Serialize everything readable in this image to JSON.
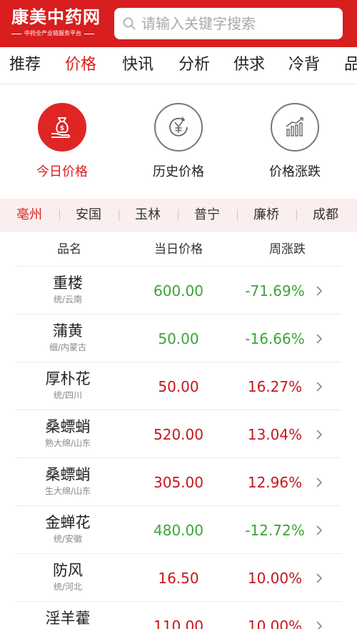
{
  "header": {
    "logo_main": "康美中药网",
    "logo_sub": "中药全产业链服务平台",
    "search_placeholder": "请输入关键字搜索"
  },
  "nav": {
    "tabs": [
      {
        "label": "推荐"
      },
      {
        "label": "价格"
      },
      {
        "label": "快讯"
      },
      {
        "label": "分析"
      },
      {
        "label": "供求"
      },
      {
        "label": "冷背"
      },
      {
        "label": "品"
      }
    ],
    "active": "价格"
  },
  "categories": [
    {
      "label": "今日价格",
      "icon": "money-bag-hand-icon"
    },
    {
      "label": "历史价格",
      "icon": "yen-history-icon"
    },
    {
      "label": "价格涨跌",
      "icon": "bar-trend-icon"
    }
  ],
  "cities": [
    {
      "label": "亳州"
    },
    {
      "label": "安国"
    },
    {
      "label": "玉林"
    },
    {
      "label": "普宁"
    },
    {
      "label": "廉桥"
    },
    {
      "label": "成都"
    }
  ],
  "table": {
    "headers": [
      "品名",
      "当日价格",
      "周涨跌"
    ],
    "rows": [
      {
        "name": "重楼",
        "spec": "统/云南",
        "price": "600.00",
        "change": "-71.69%",
        "dir": "down"
      },
      {
        "name": "蒲黄",
        "spec": "细/内蒙古",
        "price": "50.00",
        "change": "-16.66%",
        "dir": "down"
      },
      {
        "name": "厚朴花",
        "spec": "统/四川",
        "price": "50.00",
        "change": "16.27%",
        "dir": "up"
      },
      {
        "name": "桑螵蛸",
        "spec": "熟大绵/山东",
        "price": "520.00",
        "change": "13.04%",
        "dir": "up"
      },
      {
        "name": "桑螵蛸",
        "spec": "生大绵/山东",
        "price": "305.00",
        "change": "12.96%",
        "dir": "up"
      },
      {
        "name": "金蝉花",
        "spec": "统/安徽",
        "price": "480.00",
        "change": "-12.72%",
        "dir": "down"
      },
      {
        "name": "防风",
        "spec": "统/河北",
        "price": "16.50",
        "change": "10.00%",
        "dir": "up"
      },
      {
        "name": "淫羊藿",
        "spec": "",
        "price": "110.00",
        "change": "10.00%",
        "dir": "up"
      }
    ]
  },
  "colors": {
    "brand_red": "#d81e1e",
    "up_red": "#c8161d",
    "down_green": "#3aa535",
    "city_strip_bg": "#fbeeee"
  }
}
